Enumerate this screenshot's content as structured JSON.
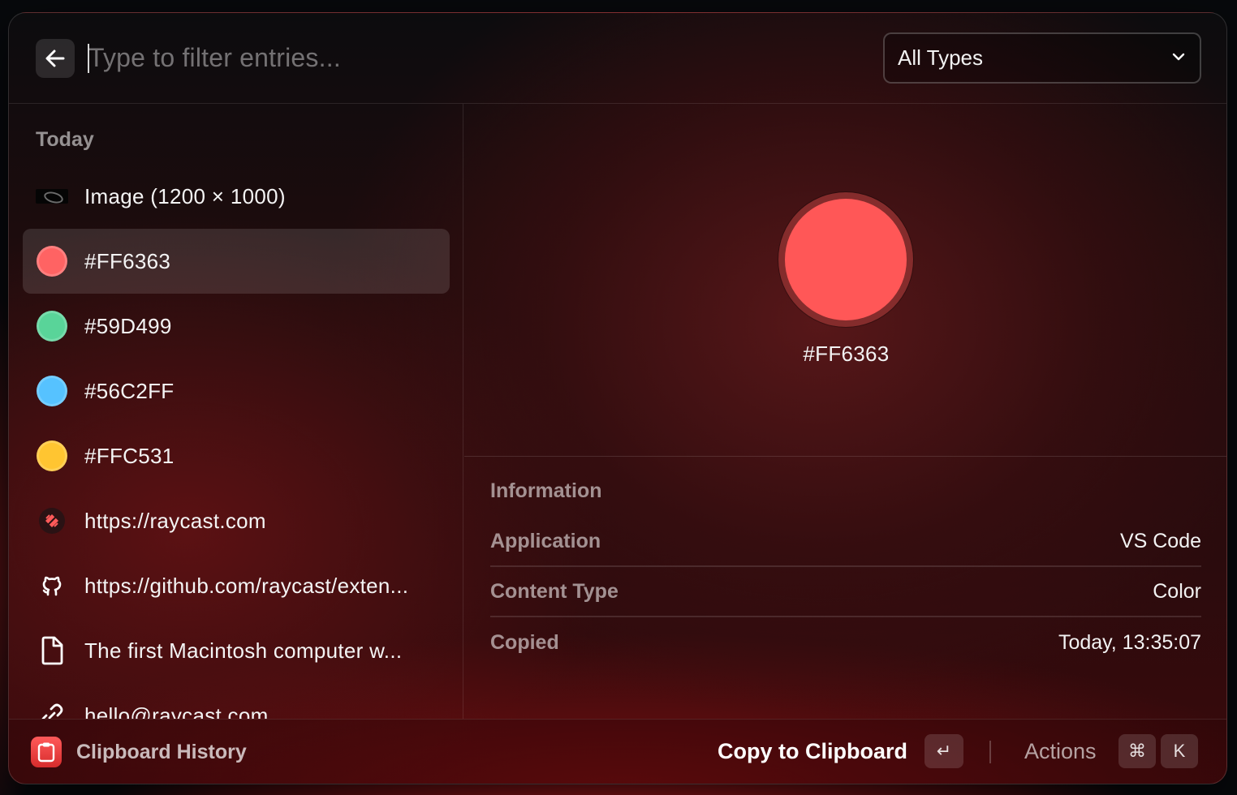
{
  "search": {
    "placeholder": "Type to filter entries..."
  },
  "filter": {
    "selected": "All Types"
  },
  "list": {
    "section": "Today",
    "items": [
      {
        "label": "Image (1200 × 1000)",
        "icon": "image-thumbnail"
      },
      {
        "label": "#FF6363",
        "color": "#FF6363",
        "icon": "color-swatch"
      },
      {
        "label": "#59D499",
        "color": "#59D499",
        "icon": "color-swatch"
      },
      {
        "label": "#56C2FF",
        "color": "#56C2FF",
        "icon": "color-swatch"
      },
      {
        "label": "#FFC531",
        "color": "#FFC531",
        "icon": "color-swatch"
      },
      {
        "label": "https://raycast.com",
        "icon": "raycast-icon"
      },
      {
        "label": "https://github.com/raycast/exten...",
        "icon": "github-icon"
      },
      {
        "label": "The first Macintosh computer w...",
        "icon": "document-icon"
      },
      {
        "label": "hello@raycast.com",
        "icon": "link-icon"
      }
    ]
  },
  "detail": {
    "color_hex": "#FF6363",
    "color": "#FF5757",
    "info_title": "Information",
    "rows": [
      {
        "key": "Application",
        "value": "VS Code"
      },
      {
        "key": "Content Type",
        "value": "Color"
      },
      {
        "key": "Copied",
        "value": "Today, 13:35:07"
      }
    ]
  },
  "footer": {
    "app_name": "Clipboard History",
    "primary_action": "Copy to Clipboard",
    "primary_key": "↵",
    "actions_label": "Actions",
    "actions_keys": [
      "⌘",
      "K"
    ]
  }
}
